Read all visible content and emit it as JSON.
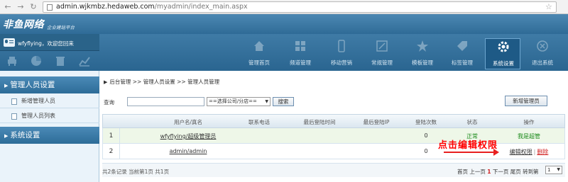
{
  "browser": {
    "url_host": "admin.wjkmbz.hedaweb.com",
    "url_path": "/myadmin/index_main.aspx"
  },
  "header": {
    "brand": "非鱼网络",
    "brand_sub": "企业建站平台"
  },
  "user": {
    "welcome": "wfyflying，欢迎您回来"
  },
  "nav": [
    {
      "label": "管理首页",
      "icon": "home-icon"
    },
    {
      "label": "频道管理",
      "icon": "grid-icon"
    },
    {
      "label": "移动营销",
      "icon": "mobile-icon"
    },
    {
      "label": "常规管理",
      "icon": "edit-icon"
    },
    {
      "label": "模板管理",
      "icon": "star-icon"
    },
    {
      "label": "标签管理",
      "icon": "tag-icon"
    },
    {
      "label": "系统设置",
      "icon": "gear-icon",
      "active": true
    },
    {
      "label": "退出系统",
      "icon": "exit-icon"
    }
  ],
  "sidebar": {
    "section1": "管理人员设置",
    "items": [
      "新增管理人员",
      "管理人员列表"
    ],
    "section2": "系统设置"
  },
  "breadcrumb": "后台管理 >> 管理人员设置 >> 管理人员管理",
  "search": {
    "label": "查询",
    "value": "",
    "select_value": "==选择公司/分店==",
    "button": "搜索",
    "add_button": "新增管理员"
  },
  "table": {
    "headers": [
      "用户名/真名",
      "联系电话",
      "最后登陆时间",
      "最后登陆IP",
      "登陆次数",
      "状态",
      "操作"
    ],
    "rows": [
      {
        "index": "1",
        "user": "wfyflying/超级管理员",
        "phone": "",
        "last_time": "",
        "last_ip": "",
        "logins": "0",
        "status": "正常",
        "op": "我是超管"
      },
      {
        "index": "2",
        "user": "admin/admin",
        "phone": "",
        "last_time": "",
        "last_ip": "",
        "logins": "0",
        "status": "",
        "op_edit": "编辑权限",
        "op_sep": "|",
        "op_delete": "删除"
      }
    ]
  },
  "callout": "点击编辑权限",
  "footer": {
    "summary": "共2条记录 当前第1页 共1页",
    "first": "首页",
    "prev": "上一页",
    "current": "1",
    "next": "下一页",
    "last": "尾页",
    "goto": "转到第",
    "page_select": "1",
    "page_suffix": "页"
  },
  "colors": {
    "header_blue": "#2f6b97",
    "callout_red": "#ff0000",
    "status_green": "#1a8a1a"
  }
}
